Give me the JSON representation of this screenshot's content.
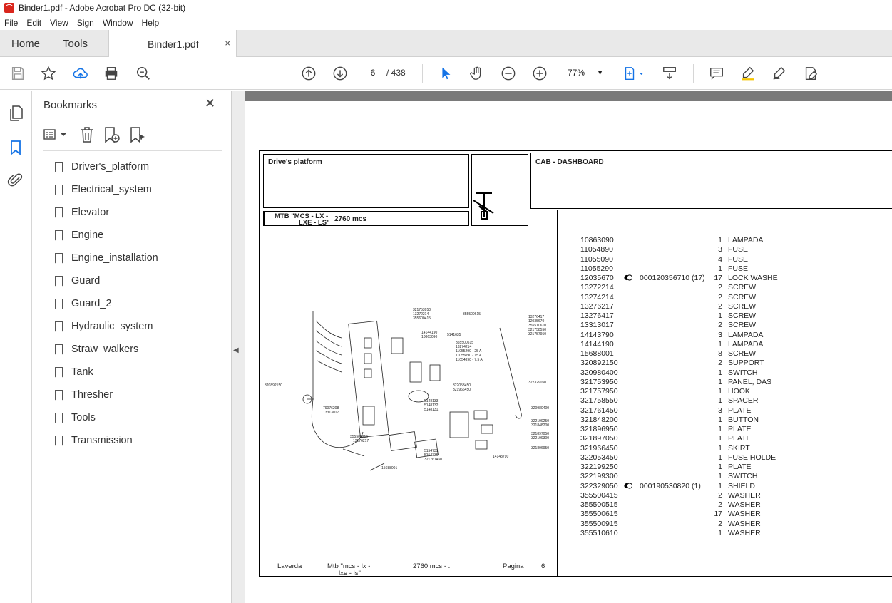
{
  "window": {
    "title": "Binder1.pdf - Adobe Acrobat Pro DC (32-bit)"
  },
  "menu": [
    "File",
    "Edit",
    "View",
    "Sign",
    "Window",
    "Help"
  ],
  "tabs": {
    "home": "Home",
    "tools": "Tools",
    "document": "Binder1.pdf",
    "close": "×"
  },
  "navigation": {
    "page": "6",
    "total": "/ 438",
    "zoom": "77%"
  },
  "bookmarks": {
    "title": "Bookmarks",
    "close": "✕",
    "items": [
      "Driver's_platform",
      "Electrical_system",
      "Elevator",
      "Engine",
      "Engine_installation",
      "Guard",
      "Guard_2",
      "Hydraulic_system",
      "Straw_walkers",
      "Tank",
      "Thresher",
      "Tools",
      "Transmission"
    ]
  },
  "sheet": {
    "section": "Drive's platform",
    "group": "CAB - DASHBOARD",
    "model_line1": "MTB \"MCS - LX -",
    "model_line2": "LXE - LS\"",
    "model_code": "2760  mcs",
    "footer": {
      "brand": "Laverda",
      "model1": "Mtb \"mcs - lx -",
      "model2": "lxe - ls\"",
      "code": "2760  mcs - .",
      "page_label": "Pagina",
      "page_no": "6"
    },
    "parts": [
      {
        "code": "10863090",
        "ref": "",
        "qty": "1",
        "desc": "LAMPADA"
      },
      {
        "code": "11054890",
        "ref": "",
        "qty": "3",
        "desc": "FUSE"
      },
      {
        "code": "11055090",
        "ref": "",
        "qty": "4",
        "desc": "FUSE"
      },
      {
        "code": "11055290",
        "ref": "",
        "qty": "1",
        "desc": "FUSE"
      },
      {
        "code": "12035670",
        "ref": "000120356710  (17)",
        "qty": "17",
        "desc": "LOCK WASHE"
      },
      {
        "code": "13272214",
        "ref": "",
        "qty": "2",
        "desc": "SCREW"
      },
      {
        "code": "13274214",
        "ref": "",
        "qty": "2",
        "desc": "SCREW"
      },
      {
        "code": "13276217",
        "ref": "",
        "qty": "2",
        "desc": "SCREW"
      },
      {
        "code": "13276417",
        "ref": "",
        "qty": "1",
        "desc": "SCREW"
      },
      {
        "code": "13313017",
        "ref": "",
        "qty": "2",
        "desc": "SCREW"
      },
      {
        "code": "14143790",
        "ref": "",
        "qty": "3",
        "desc": "LAMPADA"
      },
      {
        "code": "14144190",
        "ref": "",
        "qty": "1",
        "desc": "LAMPADA"
      },
      {
        "code": "15688001",
        "ref": "",
        "qty": "8",
        "desc": "SCREW"
      },
      {
        "code": "320892150",
        "ref": "",
        "qty": "2",
        "desc": "SUPPORT"
      },
      {
        "code": "320980400",
        "ref": "",
        "qty": "1",
        "desc": "SWITCH"
      },
      {
        "code": "321753950",
        "ref": "",
        "qty": "1",
        "desc": "PANEL, DAS"
      },
      {
        "code": "321757950",
        "ref": "",
        "qty": "1",
        "desc": "HOOK"
      },
      {
        "code": "321758550",
        "ref": "",
        "qty": "1",
        "desc": "SPACER"
      },
      {
        "code": "321761450",
        "ref": "",
        "qty": "3",
        "desc": "PLATE"
      },
      {
        "code": "321848200",
        "ref": "",
        "qty": "1",
        "desc": "BUTTON"
      },
      {
        "code": "321896950",
        "ref": "",
        "qty": "1",
        "desc": "PLATE"
      },
      {
        "code": "321897050",
        "ref": "",
        "qty": "1",
        "desc": "PLATE"
      },
      {
        "code": "321966450",
        "ref": "",
        "qty": "1",
        "desc": "SKIRT"
      },
      {
        "code": "322053450",
        "ref": "",
        "qty": "1",
        "desc": "FUSE HOLDE"
      },
      {
        "code": "322199250",
        "ref": "",
        "qty": "1",
        "desc": "PLATE"
      },
      {
        "code": "322199300",
        "ref": "",
        "qty": "1",
        "desc": "SWITCH"
      },
      {
        "code": "322329050",
        "ref": "000190530820  (1)",
        "qty": "1",
        "desc": "SHIELD"
      },
      {
        "code": "355500415",
        "ref": "",
        "qty": "2",
        "desc": "WASHER"
      },
      {
        "code": "355500515",
        "ref": "",
        "qty": "2",
        "desc": "WASHER"
      },
      {
        "code": "355500615",
        "ref": "",
        "qty": "17",
        "desc": "WASHER"
      },
      {
        "code": "355500915",
        "ref": "",
        "qty": "2",
        "desc": "WASHER"
      },
      {
        "code": "355510610",
        "ref": "",
        "qty": "1",
        "desc": "WASHER"
      }
    ],
    "diagram_labels": [
      "321753950",
      "13272214",
      "355600415",
      "14144190",
      "10863090",
      "5141635",
      "355500515",
      "13274214",
      "11055290 - 25 A",
      "11055090 - 15 A",
      "11054890 - 7,5 A",
      "355500615",
      "13276417",
      "12035670",
      "355510610",
      "321758550",
      "321757950",
      "322329050",
      "320892150",
      "322053450",
      "321966450",
      "5148133",
      "5148132",
      "5148131",
      "320980400",
      "322199250",
      "321848200",
      "321897050",
      "322199300",
      "321896950",
      "79076208",
      "13313017",
      "355500915",
      "13276217",
      "5154731",
      "5154736",
      "321761450",
      "14143790",
      "15688001"
    ]
  }
}
